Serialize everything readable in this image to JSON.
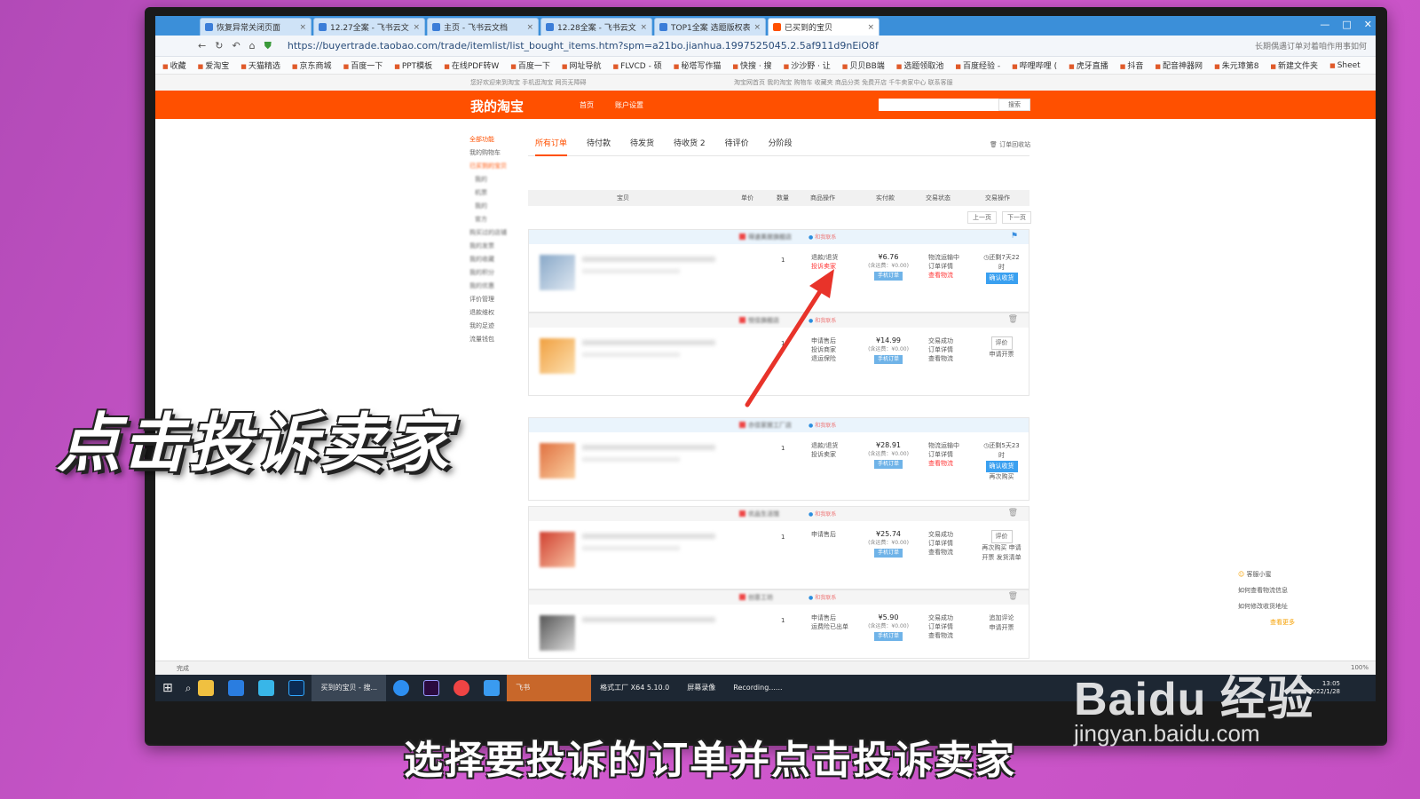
{
  "browser": {
    "tabs": [
      "恢复异常关闭页面",
      "12.27全案 - 飞书云文档",
      "主页 - 飞书云文档",
      "12.28全案 - 飞书云文档",
      "TOP1全案 选题版权表",
      "已买到的宝贝"
    ],
    "url": "https://buyertrade.taobao.com/trade/itemlist/list_bought_items.htm?spm=a21bo.jianhua.1997525045.2.5af911d9nEiO8f",
    "address_right": "长期偶遇订单对着咱作用事如何",
    "bookmarks": [
      "收藏",
      "爱淘宝",
      "天猫精选",
      "京东商城",
      "百度一下",
      "PPT模板",
      "在线PDF转W",
      "百度一下",
      "网址导航",
      "FLVCD - 硕",
      "秘塔写作猫",
      "快搜 · 搜",
      "沙沙野 · 让",
      "贝贝BB端",
      "选题领取池",
      "百度经验 -",
      "哔哩哔哩 (",
      "虎牙直播",
      "抖音",
      "配音神器网",
      "朱元璋第8",
      "新建文件夹",
      "Sheet"
    ],
    "status": "完成",
    "zoom": "100%"
  },
  "site": {
    "topnav_left": "您好欢迎来到淘宝   手机逛淘宝   网页无障碍",
    "topnav_right": "淘宝网首页   我的淘宝   购物车   收藏夹   商品分类   免费开店   千牛卖家中心   联系客服",
    "logo": "我的淘宝",
    "nav_home": "首页",
    "nav_account": "账户设置",
    "search_btn": "搜索",
    "sidebar": [
      "全部功能",
      "我的购物车",
      "已买到的宝贝",
      "我的",
      "机票",
      "我的",
      "官方",
      "购买过的店铺",
      "我的发票",
      "我的收藏",
      "我的积分",
      "我的优惠",
      "评价管理",
      "退款维权",
      "我的足迹",
      "流量钱包"
    ],
    "order_tabs": [
      "所有订单",
      "待付款",
      "待发货",
      "待收货 2",
      "待评价",
      "分阶段"
    ],
    "recycle": "订单回收站",
    "table_headers": [
      "宝贝",
      "单价",
      "数量",
      "商品操作",
      "实付款",
      "交易状态",
      "交易操作"
    ],
    "pager": [
      "上一页",
      "下一页"
    ]
  },
  "orders": [
    {
      "shop": "得速美居旗舰店",
      "contact": "和我联系",
      "qty": "1",
      "ops": [
        "退款/退货",
        "投诉卖家"
      ],
      "price": "¥6.76",
      "shipping": "(含运费：¥0.00)",
      "tag": "手机订单",
      "status": [
        "物流运输中",
        "订单详情",
        "查看物流"
      ],
      "timer": "还剩7天22时",
      "action": "确认收货",
      "extra": ""
    },
    {
      "shop": "悦佳旗舰店",
      "contact": "和我联系",
      "qty": "1",
      "ops": [
        "申请售后",
        "投诉商家",
        "退运保险"
      ],
      "price": "¥14.99",
      "shipping": "(含运费：¥0.00)",
      "tag": "手机订单",
      "status": [
        "交易成功",
        "订单详情",
        "查看物流"
      ],
      "timer": "",
      "action": "评价",
      "extra": "申请开票"
    },
    {
      "shop": "亦佳家居工厂店",
      "contact": "和我联系",
      "qty": "1",
      "ops": [
        "退款/退货",
        "投诉卖家"
      ],
      "price": "¥28.91",
      "shipping": "(含运费：¥0.00)",
      "tag": "手机订单",
      "status": [
        "物流运输中",
        "订单详情",
        "查看物流"
      ],
      "timer": "还剩5天23时",
      "action": "确认收货",
      "extra": "再次购买"
    },
    {
      "shop": "优品生活馆",
      "contact": "和我联系",
      "qty": "1",
      "ops": [
        "申请售后"
      ],
      "price": "¥25.74",
      "shipping": "(含运费：¥0.00)",
      "tag": "手机订单",
      "status": [
        "交易成功",
        "订单详情",
        "查看物流"
      ],
      "timer": "",
      "action": "评价",
      "extra": "再次购买 申请开票 发货清单"
    },
    {
      "shop": "创意工坊",
      "contact": "和我联系",
      "qty": "1",
      "ops": [
        "申请售后",
        "运费险已出单"
      ],
      "price": "¥5.90",
      "shipping": "(含运费：¥0.00)",
      "tag": "手机订单",
      "status": [
        "交易成功",
        "订单详情",
        "查看物流"
      ],
      "timer": "",
      "action": "追加评论",
      "extra": "申请开票"
    }
  ],
  "help": {
    "title": "客服小蜜",
    "items": [
      "如何查看物流信息",
      "如何修改收货地址"
    ],
    "more": "查看更多"
  },
  "taskbar": {
    "apps": [
      "买到的宝贝 - 搜...",
      "飞书",
      "格式工厂 X64 5.10.0",
      "屏幕录像",
      "Recording......"
    ],
    "time": "13:05",
    "date": "2022/1/28"
  },
  "overlay": {
    "big_text": "点击投诉卖家",
    "subtitle": "选择要投诉的订单并点击投诉卖家",
    "watermark_logo": "Baidu 经验",
    "watermark_url": "jingyan.baidu.com"
  }
}
